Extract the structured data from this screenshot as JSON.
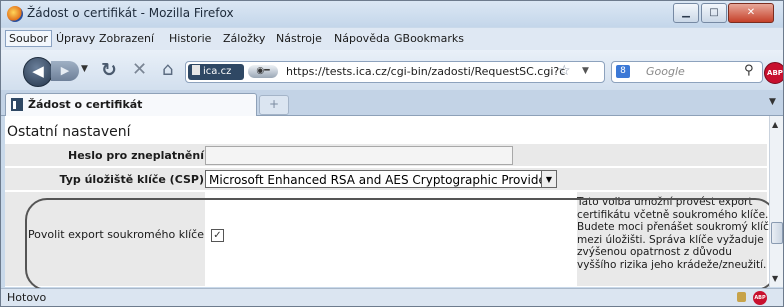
{
  "window": {
    "title": "Žádost o certifikát - Mozilla Firefox"
  },
  "menu": [
    "Soubor",
    "Úpravy",
    "Zobrazení",
    "Historie",
    "Záložky",
    "Nástroje",
    "Nápověda",
    "GBookmarks"
  ],
  "nav": {
    "site_identity": "ica.cz",
    "url": "https://tests.ica.cz/cgi-bin/zadosti/RequestSC.cgi?c",
    "search_placeholder": "Google",
    "abp_label": "ABP"
  },
  "tab": {
    "label": "Žádost o certifikát",
    "new_tab_symbol": "+"
  },
  "content": {
    "section_title": "Ostatní nastavení",
    "revocation_password_label": "Heslo pro zneplatnění",
    "revocation_password_value": "",
    "storage_label": "Typ úložiště klíče (CSP)",
    "storage_value": "Microsoft Enhanced RSA and AES Cryptographic Provider",
    "export_label": "Povolit export soukromého klíče",
    "export_checked": true,
    "export_hint": "Tato volba umožní provést export certifikátu včetně soukromého klíče. Budete moci přenášet soukromý klíč mezi úložišti. Správa klíče vyžaduje zvýšenou opatrnost z důvodu vyššího rizika jeho krádeže/zneužití."
  },
  "status": {
    "text": "Hotovo"
  },
  "icons": {
    "back": "back-arrow-icon",
    "forward": "forward-arrow-icon",
    "reload": "reload-icon",
    "stop": "stop-icon",
    "home": "home-icon",
    "star": "bookmark-star-icon",
    "search": "magnifier-icon"
  }
}
